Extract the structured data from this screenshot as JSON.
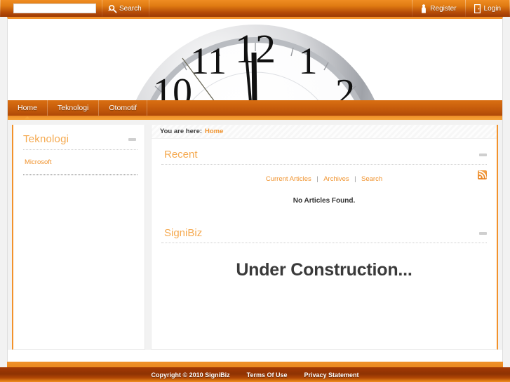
{
  "topbar": {
    "search_value": "",
    "search_placeholder": "",
    "search_label": "Search",
    "search_icon": "magnifier-icon",
    "register_label": "Register",
    "register_icon": "person-icon",
    "login_label": "Login",
    "login_icon": "door-icon"
  },
  "banner": {
    "alt": "close-up photograph of an analog clock face",
    "clock_numerals": [
      "10",
      "11",
      "12",
      "1",
      "2"
    ],
    "hands": "minute and hour hands pointing near 12"
  },
  "nav": {
    "items": [
      {
        "label": "Home",
        "active": true
      },
      {
        "label": "Teknologi",
        "active": false
      },
      {
        "label": "Otomotif",
        "active": false
      }
    ]
  },
  "sidebar": {
    "module_title": "Teknologi",
    "minimize_icon": "minimize-icon",
    "links": [
      {
        "label": "Microsoft"
      }
    ]
  },
  "breadcrumb": {
    "label": "You are here:",
    "current": "Home"
  },
  "main": {
    "recent": {
      "title": "Recent",
      "minimize_icon": "minimize-icon",
      "links": [
        {
          "label": "Current Articles"
        },
        {
          "label": "Archives"
        },
        {
          "label": "Search"
        }
      ],
      "separator": "|",
      "rss_icon": "rss-icon",
      "empty_message": "No Articles Found."
    },
    "signibiz": {
      "title": "SigniBiz",
      "minimize_icon": "minimize-icon",
      "message": "Under Construction..."
    }
  },
  "footer": {
    "copyright": "Copyright © 2010 SigniBiz",
    "terms_label": "Terms Of Use",
    "privacy_label": "Privacy Statement"
  },
  "colors": {
    "accent_orange": "#f2922b",
    "link_orange": "#f0932e",
    "title_orange": "#f5a94f",
    "header_dark": "#9c3a04",
    "page_bg": "#f2f2f2"
  }
}
